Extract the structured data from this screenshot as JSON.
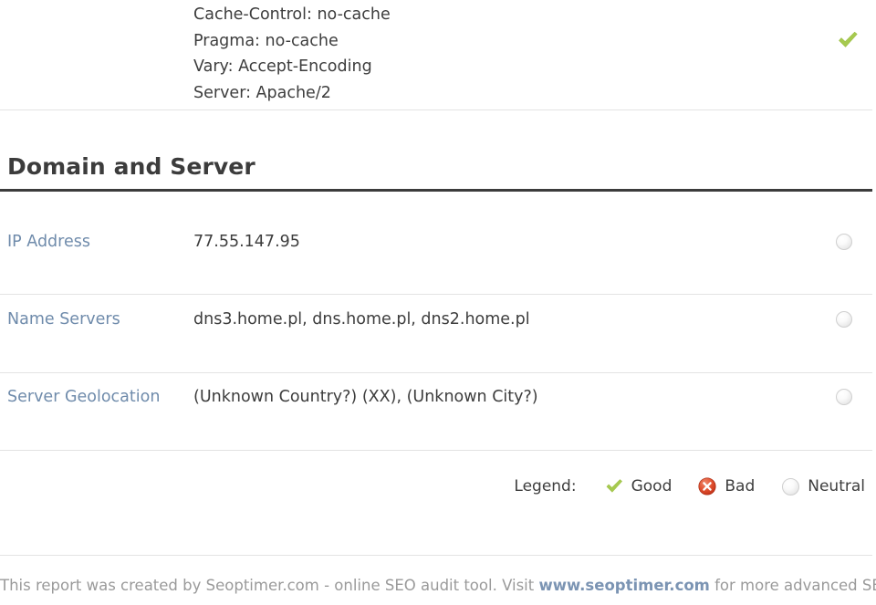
{
  "http_headers": {
    "lines": [
      "Cache-Control: no-cache",
      "Pragma: no-cache",
      "Vary: Accept-Encoding",
      "Server: Apache/2"
    ],
    "status": "good"
  },
  "section": {
    "heading": "Domain and Server",
    "rows": [
      {
        "label": "IP Address",
        "value": "77.55.147.95",
        "status": "neutral"
      },
      {
        "label": "Name Servers",
        "value": "dns3.home.pl, dns.home.pl, dns2.home.pl",
        "status": "neutral"
      },
      {
        "label": "Server Geolocation",
        "value": "(Unknown Country?) (XX), (Unknown City?)",
        "status": "neutral"
      }
    ]
  },
  "legend": {
    "title": "Legend:",
    "items": [
      {
        "icon": "check-icon",
        "label": "Good"
      },
      {
        "icon": "error-circle-icon",
        "label": "Bad"
      },
      {
        "icon": "neutral-circle-icon",
        "label": "Neutral"
      }
    ]
  },
  "footer": {
    "text_before": "This report was created by Seoptimer.com - online SEO audit tool. Visit",
    "link": "www.seoptimer.com",
    "text_after": "for more advanced SEO audits."
  },
  "colors": {
    "good": "#9ac martial",
    "good_check": "#a6ca4f",
    "bad": "#d9402a",
    "neutral": "#e6e6e6",
    "label": "#6f8bab",
    "value": "#3d3d3d",
    "heading": "#3c3c3c",
    "footer_text": "#9a9a9a",
    "footer_link": "#7b94b3"
  }
}
